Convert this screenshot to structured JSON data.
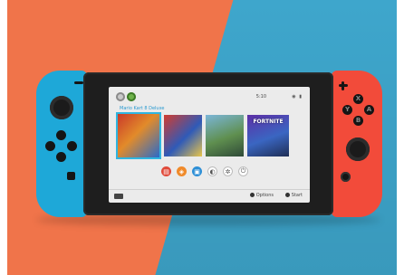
{
  "screen": {
    "time": "5:10",
    "status_icons": "◉ ▮",
    "selected_game_title": "Mario Kart 8 Deluxe",
    "tiles": [
      {
        "text": ""
      },
      {
        "text": ""
      },
      {
        "text": ""
      },
      {
        "text": "FORTNITE"
      }
    ],
    "menu_icons": [
      "news-icon",
      "shop-icon",
      "album-icon",
      "controllers-icon",
      "settings-icon",
      "power-icon"
    ],
    "hints": {
      "options": "Options",
      "start": "Start"
    }
  },
  "joycon_left": {
    "color": "#1ea8d8"
  },
  "joycon_right": {
    "color": "#f24b3a",
    "button_labels": {
      "x": "X",
      "a": "A",
      "b": "B",
      "y": "Y"
    }
  },
  "colors": {
    "background_orange": "#f0744a",
    "background_blue": "#3ea6cc",
    "accent_selection": "#2fb5e0"
  }
}
